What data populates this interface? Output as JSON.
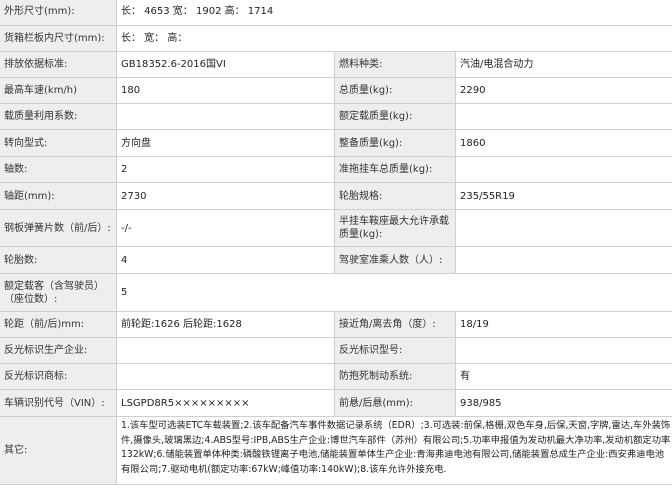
{
  "rows": {
    "r0": {
      "l1": "外形尺寸(mm):",
      "v1": "长： 4653 宽： 1902 高： 1714"
    },
    "r1": {
      "l1": "货箱栏板内尺寸(mm):",
      "v1": "长： 宽： 高："
    },
    "r2": {
      "l1": "排放依据标准:",
      "v1": "GB18352.6-2016国VI",
      "l2": "燃料种类:",
      "v2": "汽油/电混合动力"
    },
    "r3": {
      "l1": "最高车速(km/h)",
      "v1": "180",
      "l2": "总质量(kg):",
      "v2": "2290"
    },
    "r4": {
      "l1": "载质量利用系数:",
      "v1": "",
      "l2": "额定载质量(kg):",
      "v2": ""
    },
    "r5": {
      "l1": "转向型式:",
      "v1": "方向盘",
      "l2": "整备质量(kg):",
      "v2": "1860"
    },
    "r6": {
      "l1": "轴数:",
      "v1": "2",
      "l2": "准拖挂车总质量(kg):",
      "v2": ""
    },
    "r7": {
      "l1": "轴距(mm):",
      "v1": "2730",
      "l2": "轮胎规格:",
      "v2": "235/55R19"
    },
    "r8": {
      "l1": "钢板弹簧片数（前/后）:",
      "v1": "-/-",
      "l2": "半挂车鞍座最大允许承载质量(kg):",
      "v2": ""
    },
    "r9": {
      "l1": "轮胎数:",
      "v1": "4",
      "l2": "驾驶室准乘人数（人）:",
      "v2": ""
    },
    "r10": {
      "l1": "额定载客（含驾驶员）（座位数）:",
      "v1": "5"
    },
    "r11": {
      "l1": "轮距（前/后)mm:",
      "v1": "前轮距:1626 后轮距:1628",
      "l2": "接近角/离去角（度）:",
      "v2": "18/19"
    },
    "r12": {
      "l1": "反光标识生产企业:",
      "v1": "",
      "l2": "反光标识型号:",
      "v2": ""
    },
    "r13": {
      "l1": "反光标识商标:",
      "v1": "",
      "l2": "防抱死制动系统:",
      "v2": "有"
    },
    "r14": {
      "l1": "车辆识别代号（VIN）:",
      "v1": "LSGPD8R5×××××××××",
      "l2": "前悬/后悬(mm):",
      "v2": "938/985"
    },
    "r15": {
      "l1": "其它:",
      "v1": "1.该车型可选装ETC车载装置;2.该车配备汽车事件数据记录系统（EDR）;3.可选装:前保,格栅,双色车身,后保,天窗,字牌,雷达,车外装饰件,摄像头,玻璃黑边;4.ABS型号:IPB,ABS生产企业:博世汽车部件（苏州）有限公司;5.功率申报值为发动机最大净功率,发动机额定功率132kW;6.储能装置单体种类:磷酸铁锂离子电池,储能装置单体生产企业:青海弗迪电池有限公司,储能装置总成生产企业:西安弗迪电池有限公司;7.驱动电机(额定功率:67kW;峰值功率:140kW);8.该车允许外接充电."
    }
  }
}
